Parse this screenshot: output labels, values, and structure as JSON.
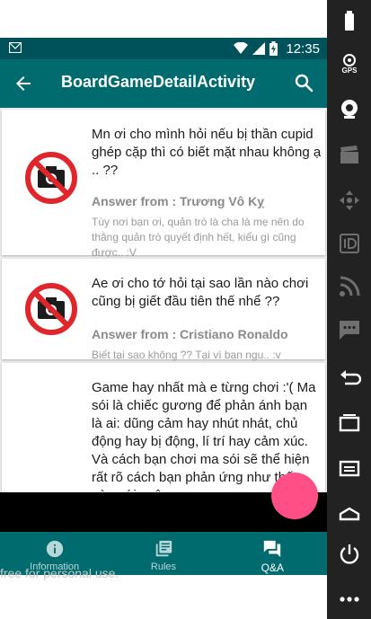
{
  "status_bar": {
    "time": "12:35"
  },
  "app_bar": {
    "title": "BoardGameDetailActivity"
  },
  "cards": [
    {
      "question": "Mn ơi cho mình hỏi nếu bị thần cupid ghép cặp thì có biết mặt nhau không ạ .. ??",
      "answer_from": "Answer from : Trương Vô Kỵ",
      "answer": "Tùy nơi bạn ơi, quản trò là cha là mẹ nên do thằng quản trò quyết định hết, kiểu gì cũng được.. :V",
      "image": "no-camera-icon"
    },
    {
      "question": "Ae ơi cho tớ hỏi tại sao lần nào chơi cũng bị giết đầu tiên thế nhể ??",
      "answer_from": "Answer from : Cristiano Ronaldo",
      "answer": "Biết tại sao không ?? Tại vì bạn ngu.. :v",
      "image": "no-camera-icon"
    },
    {
      "question": "Game hay nhất mà e từng chơi :'( Ma sói là chiếc gương để phản ánh bạn là ai: dũng cảm hay nhút nhát, chủ động hay bị động, lí trí hay cảm xúc. Và cách bạn chơi ma sói sẽ thể hiện rất rõ cách bạn phản ứng như thế nào với cuộc"
    }
  ],
  "bottom_nav": {
    "tabs": [
      {
        "label": "Information",
        "icon": "info-icon"
      },
      {
        "label": "Rules",
        "icon": "library-books-icon"
      },
      {
        "label": "Q&A",
        "icon": "forum-icon"
      }
    ],
    "active": "Q&A"
  },
  "watermark": "free for personal use.",
  "emulator_sidebar": {
    "gps_label": "GPS"
  },
  "colors": {
    "primary": "#006b6f",
    "primary_dark": "#00525a",
    "accent": "#ff4f86",
    "no_sign_red": "#e0252b"
  }
}
